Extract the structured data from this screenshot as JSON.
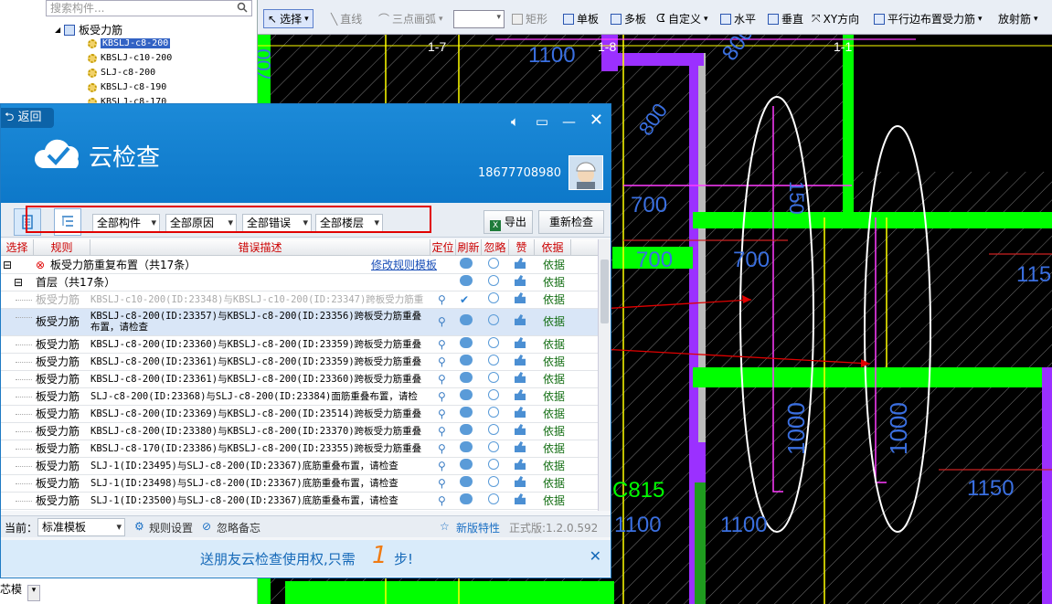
{
  "tree": {
    "search_placeholder": "搜索构件...",
    "root_label": "板受力筋",
    "items": [
      {
        "label": "KBSLJ-c8-200",
        "selected": true
      },
      {
        "label": "KBSLJ-c10-200",
        "selected": false
      },
      {
        "label": "SLJ-c8-200",
        "selected": false
      },
      {
        "label": "KBSLJ-c8-190",
        "selected": false
      },
      {
        "label": "KBSLJ-c8-170",
        "selected": false
      }
    ],
    "footer_label": "芯模"
  },
  "toolbar": {
    "select": "选择",
    "line": "直线",
    "arc": "三点画弧",
    "rect": "矩形",
    "single": "单板",
    "multi": "多板",
    "custom": "自定义",
    "horizontal": "水平",
    "vertical": "垂直",
    "xy": "XY方向",
    "parallel": "平行边布置受力筋",
    "radial": "放射筋"
  },
  "canvas": {
    "labels": [
      "1100",
      "800",
      "700",
      "800",
      "700",
      "700",
      "700",
      "150",
      "1000",
      "1000",
      "1150",
      "1150",
      "C815",
      "1100",
      "1100",
      "1-7",
      "1-8",
      "1-1"
    ]
  },
  "dialog": {
    "back": "返回",
    "title": "云检查",
    "phone": "18677708980",
    "filters": [
      "全部构件",
      "全部原因",
      "全部错误",
      "全部楼层"
    ],
    "export": "导出",
    "recheck": "重新检查",
    "columns": [
      "选择",
      "规则",
      "错误描述",
      "定位",
      "刷新",
      "忽略",
      "赞",
      "依据"
    ],
    "group_title": "板受力筋重复布置（共17条）",
    "group_link": "修改规则模板",
    "floor_title": "首层（共17条）",
    "basis": "依据",
    "rows": [
      {
        "cat": "板受力筋",
        "desc": "KBSLJ-c10-200(ID:23348)与KBSLJ-c10-200(ID:23347)跨板受力筋重",
        "dim": true
      },
      {
        "cat": "板受力筋",
        "desc": "KBSLJ-c8-200(ID:23357)与KBSLJ-c8-200(ID:23356)跨板受力筋重叠布置，请检查",
        "selected": true
      },
      {
        "cat": "板受力筋",
        "desc": "KBSLJ-c8-200(ID:23360)与KBSLJ-c8-200(ID:23359)跨板受力筋重叠"
      },
      {
        "cat": "板受力筋",
        "desc": "KBSLJ-c8-200(ID:23361)与KBSLJ-c8-200(ID:23359)跨板受力筋重叠"
      },
      {
        "cat": "板受力筋",
        "desc": "KBSLJ-c8-200(ID:23361)与KBSLJ-c8-200(ID:23360)跨板受力筋重叠"
      },
      {
        "cat": "板受力筋",
        "desc": "SLJ-c8-200(ID:23368)与SLJ-c8-200(ID:23384)面筋重叠布置，请检"
      },
      {
        "cat": "板受力筋",
        "desc": "KBSLJ-c8-200(ID:23369)与KBSLJ-c8-200(ID:23514)跨板受力筋重叠"
      },
      {
        "cat": "板受力筋",
        "desc": "KBSLJ-c8-200(ID:23380)与KBSLJ-c8-200(ID:23370)跨板受力筋重叠"
      },
      {
        "cat": "板受力筋",
        "desc": "KBSLJ-c8-170(ID:23386)与KBSLJ-c8-200(ID:23355)跨板受力筋重叠"
      },
      {
        "cat": "板受力筋",
        "desc": "SLJ-1(ID:23495)与SLJ-c8-200(ID:23367)底筋重叠布置，请检查"
      },
      {
        "cat": "板受力筋",
        "desc": "SLJ-1(ID:23498)与SLJ-c8-200(ID:23367)底筋重叠布置，请检查"
      },
      {
        "cat": "板受力筋",
        "desc": "SLJ-1(ID:23500)与SLJ-c8-200(ID:23367)底筋重叠布置，请检查"
      }
    ],
    "status": {
      "current_label": "当前：",
      "template": "标准模板",
      "rule_settings": "规则设置",
      "ignore_notes": "忽略备忘",
      "new_features": "新版特性",
      "version": "正式版:1.2.0.592"
    },
    "banner": {
      "text_before": "送朋友云检查使用权,只需",
      "number": "1",
      "text_after": "步!"
    }
  },
  "colors": {
    "dialog_blue": "#1a86d5",
    "selected_row": "#d9e6f7",
    "error_red": "#e00000",
    "cad_green": "#00ff00",
    "cad_purple": "#9b30ff"
  }
}
